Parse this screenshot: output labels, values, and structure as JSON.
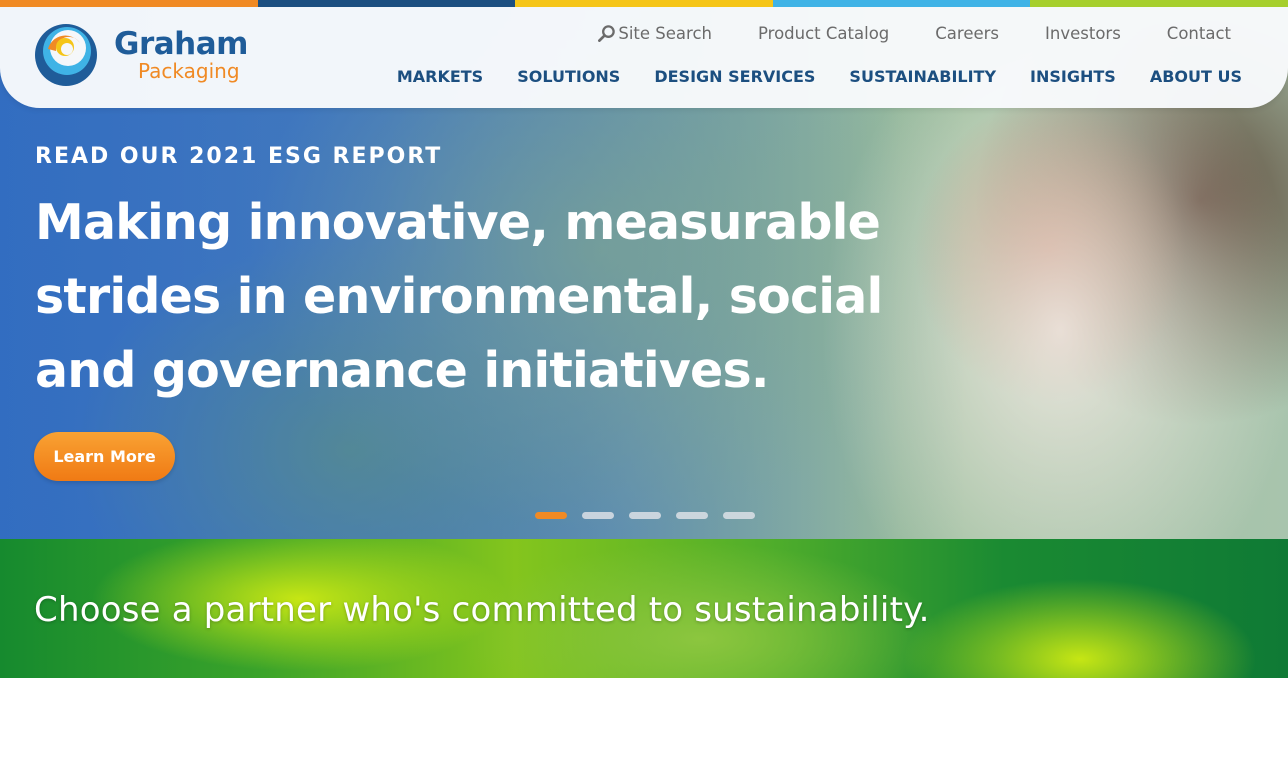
{
  "brand": {
    "name_line1": "Graham",
    "name_line2": "Packaging",
    "colors": {
      "blue": "#1f5c99",
      "orange": "#f08a24",
      "yellow": "#f5c518",
      "light_blue": "#3fb3e6",
      "lime": "#a6cf2c"
    }
  },
  "top_stripe": [
    "#f08a24",
    "#1c4f80",
    "#f5c518",
    "#3fb3e6",
    "#a6cf2c"
  ],
  "utility_nav": [
    {
      "label": "Site Search",
      "icon": "search-icon"
    },
    {
      "label": "Product Catalog"
    },
    {
      "label": "Careers"
    },
    {
      "label": "Investors"
    },
    {
      "label": "Contact"
    }
  ],
  "main_nav": [
    {
      "label": "MARKETS"
    },
    {
      "label": "SOLUTIONS"
    },
    {
      "label": "DESIGN SERVICES"
    },
    {
      "label": "SUSTAINABILITY"
    },
    {
      "label": "INSIGHTS"
    },
    {
      "label": "ABOUT US"
    }
  ],
  "hero": {
    "eyebrow": "READ OUR 2021 ESG REPORT",
    "headline": "Making innovative, measurable strides in environmental, social and governance initiatives.",
    "cta_label": "Learn More",
    "slides_count": 5,
    "active_slide": 1
  },
  "banner": {
    "text": "Choose a partner who's committed to sustainability."
  }
}
